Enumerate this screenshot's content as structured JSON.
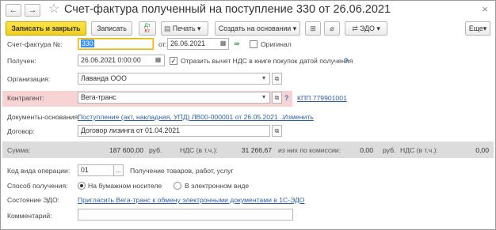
{
  "window": {
    "title": "Счет-фактура полученный на поступление 330 от 26.06.2021",
    "back_glyph": "←",
    "forward_glyph": "→",
    "star_glyph": "☆",
    "close_glyph": "×"
  },
  "toolbar": {
    "save_close": "Записать и закрыть",
    "save": "Записать",
    "dt_kt_top": "Дт",
    "dt_kt_bottom": "Кт",
    "print": "Печать",
    "create_based": "Создать на основании",
    "edo": "ЭДО",
    "dropdown_glyph": "▾"
  },
  "form": {
    "invoice_label": "Счет-фактура №:",
    "invoice_number": "330",
    "from_label": "от:",
    "invoice_date": "26.06.2021",
    "original_label": "Оригинал",
    "original_checked": false,
    "received_label": "Получен:",
    "received_datetime": "26.06.2021  0:00:00",
    "vat_deduction_label": "Отразить вычет НДС в книге покупок датой получения",
    "vat_deduction_checked": true,
    "help_glyph": "?",
    "org_label": "Организация:",
    "org_value": "Лаванда ООО",
    "counterparty_label": "Контрагент:",
    "counterparty_value": "Вега-транс",
    "kpp_link": "КПП 779901001",
    "base_docs_label": "Документы-основания:",
    "base_docs_link": "Поступление (акт, накладная, УПД) ЛВ00-000001 от 26.05.2021 ...",
    "change_link": "Изменить",
    "contract_label": "Договор:",
    "contract_value": "Договор лизинга от 01.04.2021",
    "open_glyph": "⧉",
    "dots_glyph": "..."
  },
  "totals": {
    "sum_label": "Сумма:",
    "sum_value": "187 600,00",
    "currency1": "руб.",
    "vat_label1": "НДС (в т.ч.):",
    "vat_value1": "31 266,67",
    "commission_label": "из них по комиссии:",
    "commission_value": "0,00",
    "currency2": "руб.",
    "vat_label2": "НДС (в т.ч.):",
    "vat_value2": "0,00"
  },
  "operation": {
    "op_code_label": "Код вида операции:",
    "op_code_value": "01",
    "op_code_desc": "Получение товаров, работ, услуг",
    "method_label": "Способ получения:",
    "method_paper": "На бумажном носителе",
    "method_electronic": "В электронном виде",
    "method_selected": "paper",
    "edo_state_label": "Состояние ЭДО:",
    "edo_invite_link": "Пригласить Вега-транс к обмену электронными документами в 1С-ЭДО",
    "comment_label": "Комментарий:",
    "comment_value": ""
  },
  "colors": {
    "primary_button": "#f1ce1a",
    "required_highlight": "#f8d3d3",
    "totals_band": "#dcdcdc",
    "link": "#2f5fa7"
  }
}
